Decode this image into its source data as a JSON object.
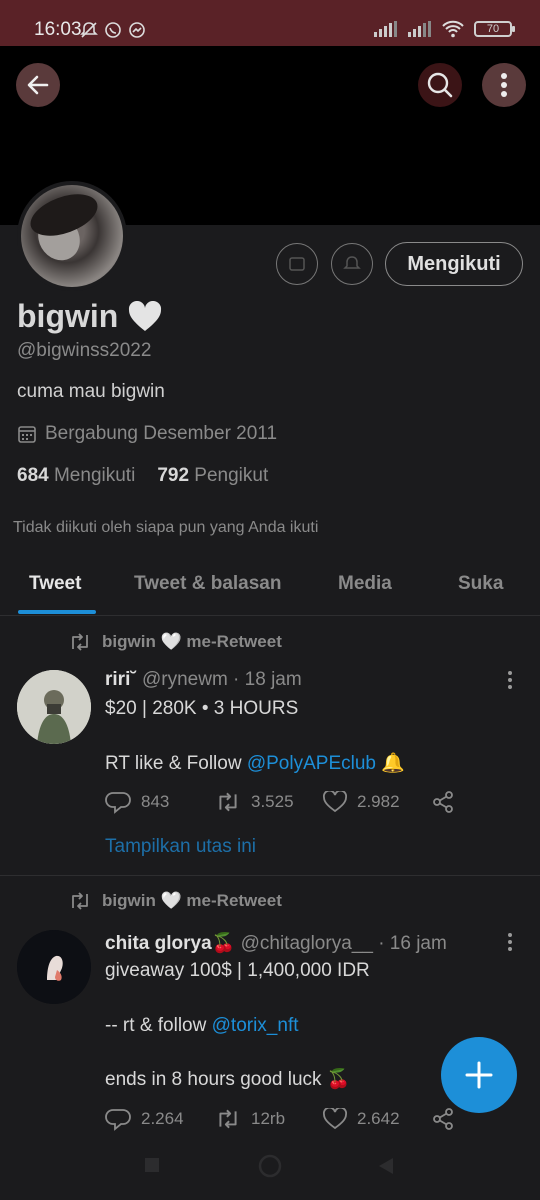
{
  "status_bar": {
    "time": "16:03",
    "battery": "70"
  },
  "profile": {
    "name": "bigwin",
    "handle": "@bigwinss2022",
    "bio": "cuma mau bigwin",
    "joined": "Bergabung Desember 2011",
    "following_count": "684",
    "following_label": "Mengikuti",
    "followers_count": "792",
    "followers_label": "Pengikut",
    "not_followed_note": "Tidak diikuti oleh siapa pun yang Anda ikuti",
    "follow_button": "Mengikuti"
  },
  "tabs": [
    {
      "label": "Tweet"
    },
    {
      "label": "Tweet & balasan"
    },
    {
      "label": "Media"
    },
    {
      "label": "Suka"
    }
  ],
  "tweets": [
    {
      "retweet_by": "bigwin 🤍 me-Retweet",
      "display_name": "riri˘",
      "handle": "@rynewm",
      "time": "· 18 jam",
      "line1": "$20 | 280K • 3 HOURS",
      "line2_prefix": "RT like & Follow ",
      "line2_link": "@PolyAPEclub",
      "line2_suffix": " 🔔",
      "replies": "843",
      "retweets": "3.525",
      "likes": "2.982",
      "show_thread": "Tampilkan utas ini"
    },
    {
      "retweet_by": "bigwin 🤍 me-Retweet",
      "display_name": "chita glorya🍒",
      "handle": "@chitaglorya__",
      "time": "· 16 jam",
      "line1": "giveaway 100$ | 1,400,000 IDR",
      "line2_prefix": "-- rt & follow ",
      "line2_link": "@torix_nft",
      "line3": "ends in 8 hours good luck 🍒",
      "replies": "2.264",
      "retweets": "12rb",
      "likes": "2.642"
    }
  ],
  "colors": {
    "accent": "#1d8fd8",
    "background": "#1b1b1d",
    "status_bar": "#5a2227"
  }
}
